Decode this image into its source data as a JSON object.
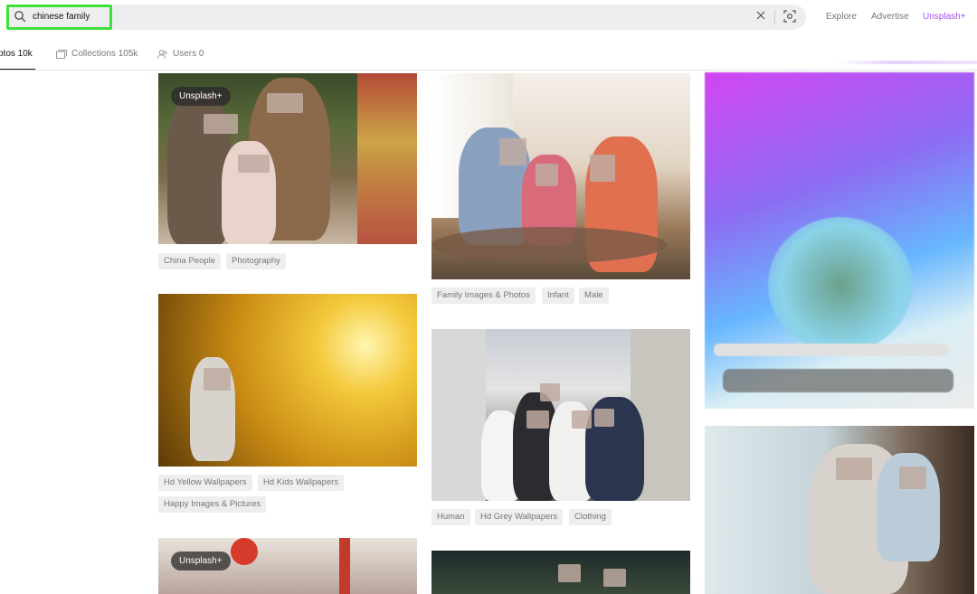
{
  "header": {
    "search": {
      "value": "chinese family",
      "placeholder": ""
    },
    "nav": {
      "explore": "Explore",
      "advertise": "Advertise",
      "unsplash_plus": "Unsplash+"
    }
  },
  "tabs": {
    "photos": "otos 10k",
    "collections": "Collections 105k",
    "users": "Users 0"
  },
  "photos": [
    {
      "badge": "Unsplash+",
      "tags": [
        "China People",
        "Photography"
      ]
    },
    {
      "tags": [
        "Hd Yellow Wallpapers",
        "Hd Kids Wallpapers",
        "Happy Images & Pictures"
      ]
    },
    {
      "badge": "Unsplash+",
      "tags": []
    },
    {
      "tags": [
        "Family Images & Photos",
        "Infant",
        "Male"
      ]
    },
    {
      "tags": [
        "Human",
        "Hd Grey Wallpapers",
        "Clothing"
      ]
    },
    {
      "tags": []
    }
  ],
  "colors": {
    "accent_unsplash_plus": "#a24ff0",
    "search_highlight": "#3ee03a",
    "tag_bg": "#eeeeee"
  }
}
